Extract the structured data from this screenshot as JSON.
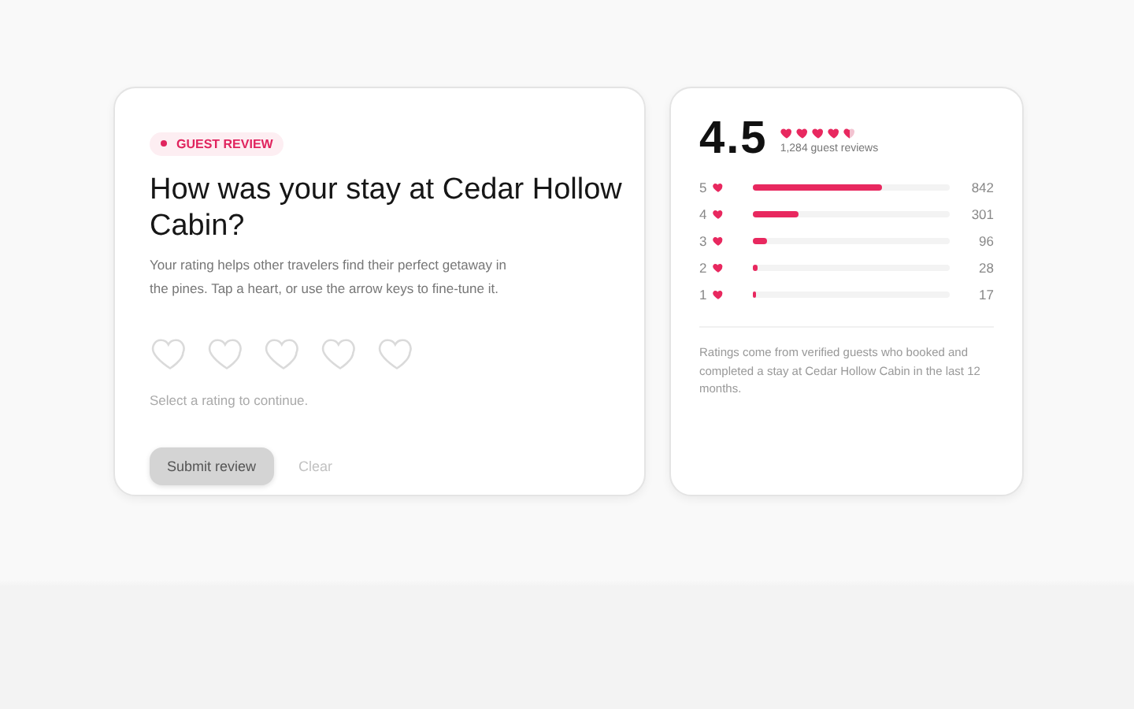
{
  "review_card": {
    "badge": "GUEST REVIEW",
    "title": "How was your stay at Cedar Hollow Cabin?",
    "description": "Your rating helps other travelers find their perfect getaway in the pines. Tap a heart, or use the arrow keys to fine-tune it.",
    "rating_hearts": [
      {
        "filled": false
      },
      {
        "filled": false
      },
      {
        "filled": false
      },
      {
        "filled": false
      },
      {
        "filled": false
      }
    ],
    "hint": "Select a rating to continue.",
    "submit": {
      "label": "Submit review",
      "disabled": true
    },
    "clear": {
      "label": "Clear"
    }
  },
  "summary_card": {
    "score": "4.5",
    "stars": 4.5,
    "review_count": "1,284 guest reviews",
    "breakdown": [
      {
        "label": "5",
        "level": 0.656,
        "count": "842"
      },
      {
        "label": "4",
        "level": 0.234,
        "count": "301"
      },
      {
        "label": "3",
        "level": 0.075,
        "count": "96"
      },
      {
        "label": "2",
        "level": 0.022,
        "count": "28"
      },
      {
        "label": "1",
        "level": 0.013,
        "count": "17"
      }
    ],
    "note": "Ratings come from verified guests who booked and completed a stay at Cedar Hollow Cabin in the last 12 months."
  }
}
